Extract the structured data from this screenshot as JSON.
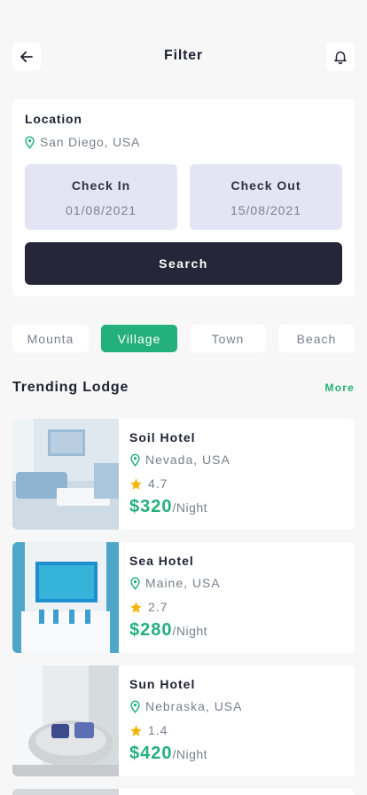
{
  "header": {
    "title": "Filter",
    "back_icon": "arrow-left-icon",
    "notify_icon": "bell-icon"
  },
  "filter": {
    "location_label": "Location",
    "location_value": "San Diego, USA",
    "check_in_label": "Check In",
    "check_in_value": "01/08/2021",
    "check_out_label": "Check Out",
    "check_out_value": "15/08/2021",
    "search_label": "Search"
  },
  "categories": [
    {
      "label": "Mounta",
      "active": false
    },
    {
      "label": "Village",
      "active": true
    },
    {
      "label": "Town",
      "active": false
    },
    {
      "label": "Beach",
      "active": false
    }
  ],
  "trending": {
    "title": "Trending Lodge",
    "more_label": "More",
    "items": [
      {
        "name": "Soil Hotel",
        "location": "Nevada, USA",
        "rating": "4.7",
        "price": "$320",
        "per": "/Night"
      },
      {
        "name": "Sea Hotel",
        "location": "Maine, USA",
        "rating": "2.7",
        "price": "$280",
        "per": "/Night"
      },
      {
        "name": "Sun Hotel",
        "location": "Nebraska, USA",
        "rating": "1.4",
        "price": "$420",
        "per": "/Night"
      }
    ]
  },
  "colors": {
    "accent": "#24b07c",
    "dark": "#252638",
    "date_bg": "#e4e4f5",
    "star": "#f5b400"
  }
}
